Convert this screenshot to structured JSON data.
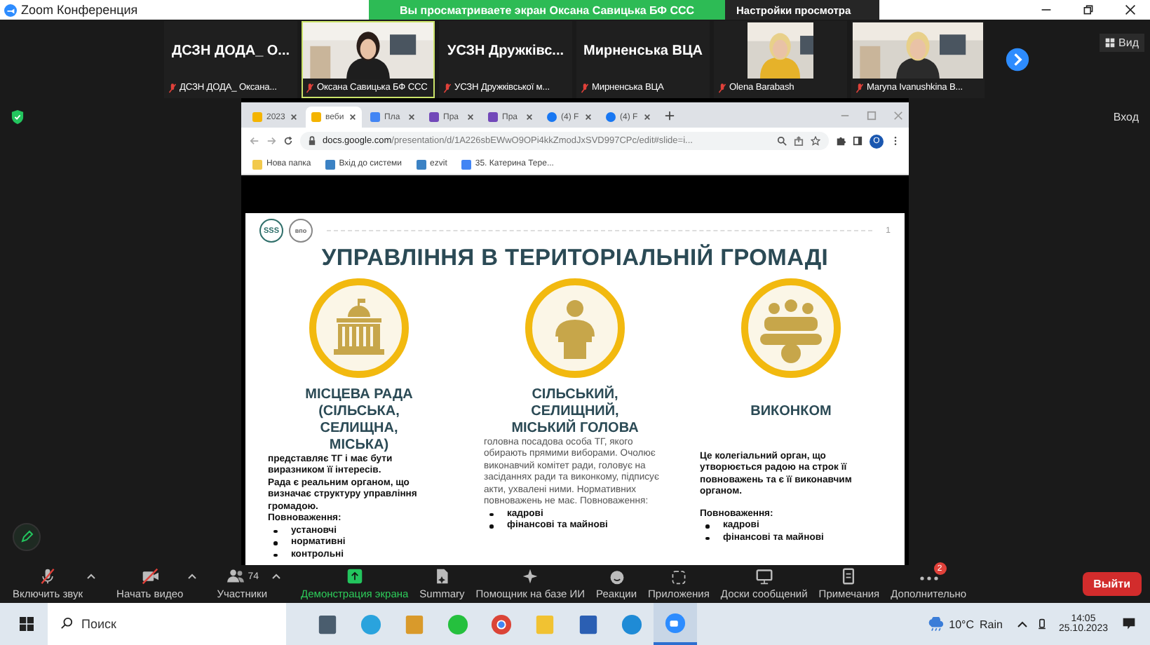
{
  "window": {
    "title": "Zoom Конференция"
  },
  "share_banner": {
    "text": "Вы просматриваете экран Оксана Савицька БФ ССС",
    "settings_button": "Настройки просмотра"
  },
  "gallery": {
    "view_button": "Вид",
    "participants": [
      {
        "kind": "name",
        "display": "ДСЗН ДОДА_ О...",
        "label": "ДСЗН ДОДА_ Оксана...",
        "speaking": false
      },
      {
        "kind": "video",
        "label": "Оксана Савицька БФ ССС",
        "speaking": true
      },
      {
        "kind": "name",
        "display": "УСЗН Дружківс...",
        "label": "УСЗН Дружківської м...",
        "speaking": false
      },
      {
        "kind": "name",
        "display": "Мирненська ВЦА",
        "label": "Мирненська ВЦА",
        "speaking": false
      },
      {
        "kind": "video",
        "label": "Olena Barabash",
        "speaking": false
      },
      {
        "kind": "video",
        "label": "Maryna Ivanushkina B...",
        "speaking": false
      }
    ]
  },
  "side_label": "Вход",
  "browser": {
    "tabs": [
      {
        "kind": "drive",
        "label": "2023",
        "selected": false
      },
      {
        "kind": "slides",
        "label": "веби",
        "selected": true
      },
      {
        "kind": "docs",
        "label": "Пла",
        "selected": false
      },
      {
        "kind": "forms",
        "label": "Пра",
        "selected": false
      },
      {
        "kind": "forms",
        "label": "Пра",
        "selected": false
      },
      {
        "kind": "facebook",
        "label": "(4) F",
        "selected": false
      },
      {
        "kind": "facebook",
        "label": "(4) F",
        "selected": false
      }
    ],
    "url_host": "docs.google.com",
    "url_path": "/presentation/d/1A226sbEWwO9OPi4kkZmodJxSVD997CPc/edit#slide=i...",
    "profile": "О",
    "bookmarks": [
      {
        "kind": "folder",
        "label": "Нова папка"
      },
      {
        "kind": "grid",
        "label": "Вхід до системи"
      },
      {
        "kind": "grid",
        "label": "ezvit"
      },
      {
        "kind": "docs",
        "label": "35. Катерина Тере..."
      }
    ]
  },
  "slide": {
    "logo_left": "SSS",
    "logo_right": "впо",
    "page_number": "1",
    "title": "УПРАВЛІННЯ В ТЕРИТОРІАЛЬНІЙ ГРОМАДІ",
    "columns": [
      {
        "kind": "building",
        "heading": "МІСЦЕВА РАДА (СІЛЬСЬКА, СЕЛИЩНА, МІСЬКА)",
        "paragraphs": [
          "представляє ТГ і має бути виразником її інтересів.",
          "Рада є реальним органом, що визначає структуру управління громадою.",
          "Повноваження:"
        ],
        "bullets": [
          "установчі",
          "нормативні",
          "контрольні"
        ]
      },
      {
        "kind": "speaker",
        "heading": "СІЛЬСЬКИЙ, СЕЛИЩНИЙ, МІСЬКИЙ ГОЛОВА",
        "paragraphs": [
          "головна посадова особа ТГ, якого обирають прямими виборами. Очолює виконавчий комітет ради, головує на засіданнях ради та виконкому, підписує акти, ухвалені ними. Нормативних повноважень не має. Повноваження:"
        ],
        "bullets": [
          "кадрові",
          "фінансові та майнові"
        ]
      },
      {
        "kind": "team",
        "heading": "ВИКОНКОМ",
        "paragraphs": [
          "Це колегіальний орган, що утворюється радою на строк її повноважень та є її виконавчим органом.",
          "Повноваження:"
        ],
        "bullets": [
          "кадрові",
          "фінансові та майнові"
        ]
      }
    ]
  },
  "toolbar": {
    "items": [
      {
        "kind": "mic",
        "label": "Включить звук",
        "active": false
      },
      {
        "kind": "video",
        "label": "Начать видео",
        "active": false
      },
      {
        "kind": "participants",
        "label": "Участники",
        "count": "74",
        "active": false
      },
      {
        "kind": "share",
        "label": "Демонстрация экрана",
        "active": true
      },
      {
        "kind": "summary",
        "label": "Summary",
        "active": false
      },
      {
        "kind": "assistant",
        "label": "Помощник на базе ИИ",
        "active": false
      },
      {
        "kind": "reactions",
        "label": "Реакции",
        "active": false
      },
      {
        "kind": "apps",
        "label": "Приложения",
        "active": false
      },
      {
        "kind": "whiteboard",
        "label": "Доски сообщений",
        "active": false
      },
      {
        "kind": "notes",
        "label": "Примечания",
        "active": false
      },
      {
        "kind": "more",
        "label": "Дополнительно",
        "badge": "2",
        "active": false
      }
    ],
    "leave_button": "Выйти"
  },
  "taskbar": {
    "search_placeholder": "Поиск",
    "apps": [
      {
        "kind": "calculator",
        "selected": false
      },
      {
        "kind": "telegram",
        "selected": false
      },
      {
        "kind": "paint",
        "selected": false
      },
      {
        "kind": "whatsapp",
        "selected": false
      },
      {
        "kind": "chrome",
        "selected": false
      },
      {
        "kind": "folder",
        "selected": false
      },
      {
        "kind": "word",
        "selected": false
      },
      {
        "kind": "edge",
        "selected": false
      },
      {
        "kind": "zoom",
        "selected": true
      }
    ],
    "weather_temp": "10°C",
    "weather_text": "Rain",
    "time": "14:05",
    "date": "25.10.2023"
  }
}
